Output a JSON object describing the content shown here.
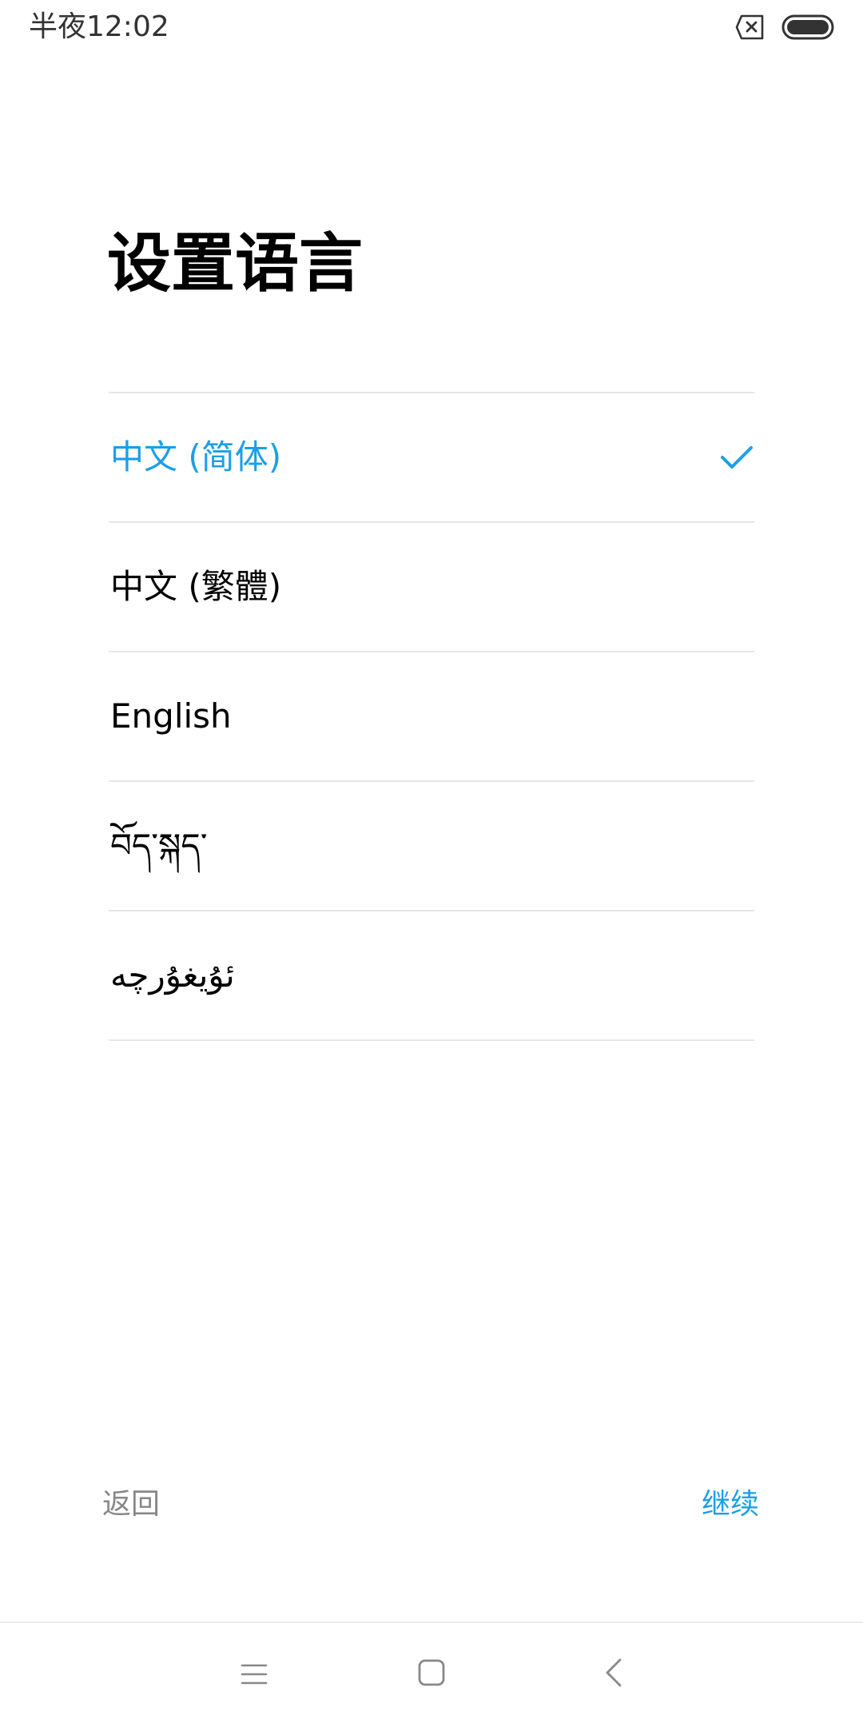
{
  "status_bar": {
    "time": "半夜12:02",
    "icons": [
      "no-sim-icon",
      "battery-full-icon"
    ]
  },
  "page": {
    "title": "设置语言"
  },
  "languages": [
    {
      "label": "中文 (简体)",
      "selected": true
    },
    {
      "label": "中文 (繁體)",
      "selected": false
    },
    {
      "label": "English",
      "selected": false
    },
    {
      "label": "བོད་སྐད་",
      "selected": false
    },
    {
      "label": "ئۇيغۇرچە",
      "selected": false
    }
  ],
  "actions": {
    "back_label": "返回",
    "continue_label": "继续"
  },
  "nav_bar": {
    "icons": [
      "menu-icon",
      "home-icon",
      "back-arrow-icon"
    ]
  },
  "colors": {
    "accent": "#1a9fe8",
    "divider": "#e6e6e6",
    "secondary_text": "#888888"
  }
}
